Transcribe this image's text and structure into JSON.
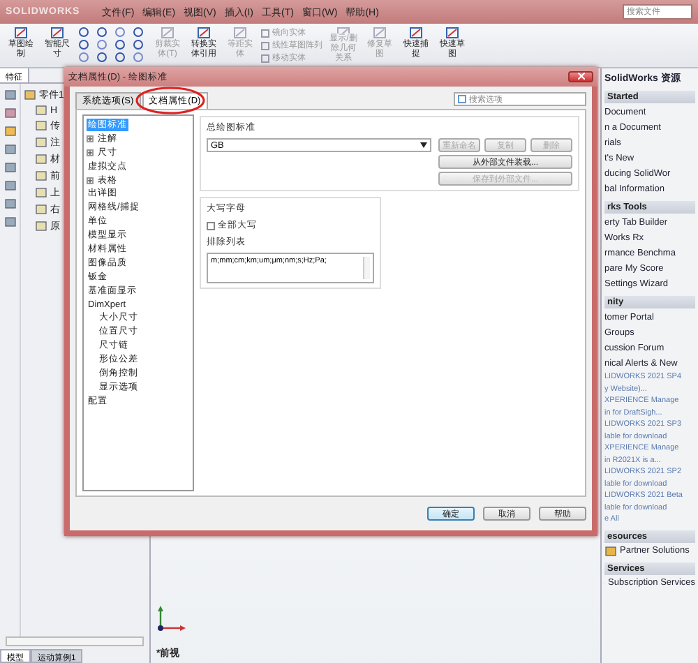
{
  "menu_bar": {
    "logo": "SOLIDWORKS",
    "items": [
      "文件(F)",
      "编辑(E)",
      "视图(V)",
      "插入(I)",
      "工具(T)",
      "窗口(W)",
      "帮助(H)"
    ],
    "search": {
      "placeholder": "搜索文件"
    }
  },
  "ribbon": {
    "groups": [
      {
        "kind": "large",
        "tools": [
          {
            "label": "草图绘制",
            "disabled": false
          },
          {
            "label": "智能尺寸",
            "disabled": false
          }
        ]
      },
      {
        "kind": "icons"
      },
      {
        "kind": "large",
        "tools": [
          {
            "label": "剪裁实体(T)",
            "disabled": true
          },
          {
            "label": "转换实体引用",
            "disabled": false
          },
          {
            "label": "等距实体",
            "disabled": true
          }
        ]
      },
      {
        "kind": "stack",
        "tools": [
          {
            "label": "镜向实体",
            "disabled": true
          },
          {
            "label": "线性草图阵列",
            "disabled": true
          },
          {
            "label": "移动实体",
            "disabled": true
          }
        ]
      },
      {
        "kind": "large",
        "tools": [
          {
            "label": "显示/删除几何关系",
            "disabled": true
          },
          {
            "label": "修复草图",
            "disabled": true
          },
          {
            "label": "快速捕捉",
            "disabled": false
          },
          {
            "label": "快速草图",
            "disabled": false
          }
        ]
      }
    ]
  },
  "feature_manager": {
    "tabs": [
      {
        "label": "特征",
        "selected": true
      }
    ],
    "tree": [
      {
        "label": "零件1",
        "children": [
          {
            "label": "H"
          },
          {
            "label": "传"
          },
          {
            "label": "注"
          },
          {
            "label": "材"
          },
          {
            "label": "前"
          },
          {
            "label": "上"
          },
          {
            "label": "右"
          },
          {
            "label": "原"
          }
        ]
      }
    ],
    "bottom_tabs": [
      {
        "label": "模型",
        "selected": true
      },
      {
        "label": "运动算例1",
        "selected": false
      }
    ]
  },
  "graphics": {
    "view_label": "*前视"
  },
  "task_pane": {
    "title": "SolidWorks 资源",
    "sections": [
      {
        "title": "Started",
        "items": [
          {
            "kind": "link",
            "label": "Document"
          },
          {
            "kind": "link",
            "label": "n a Document"
          },
          {
            "kind": "link",
            "label": "rials"
          },
          {
            "kind": "link",
            "label": "t's New"
          },
          {
            "kind": "link",
            "label": "ducing SolidWor"
          },
          {
            "kind": "link",
            "label": "bal Information"
          }
        ]
      },
      {
        "title": "rks Tools",
        "items": [
          {
            "kind": "link",
            "label": "erty Tab Builder"
          },
          {
            "kind": "link",
            "label": "Works Rx"
          },
          {
            "kind": "link",
            "label": "rmance Benchma"
          },
          {
            "kind": "link",
            "label": "pare My Score"
          },
          {
            "kind": "link",
            "label": "Settings Wizard"
          }
        ]
      },
      {
        "title": "nity",
        "items": [
          {
            "kind": "link",
            "label": "tomer Portal"
          },
          {
            "kind": "link",
            "label": "Groups"
          },
          {
            "kind": "link",
            "label": "cussion Forum"
          },
          {
            "kind": "link",
            "label": "nical Alerts & New"
          },
          {
            "kind": "news",
            "label": "LIDWORKS 2021 SP4"
          },
          {
            "kind": "news",
            "label": "y Website)..."
          },
          {
            "kind": "news",
            "label": "XPERIENCE Manage"
          },
          {
            "kind": "news",
            "label": "in for DraftSigh..."
          },
          {
            "kind": "news",
            "label": "LIDWORKS 2021 SP3"
          },
          {
            "kind": "news",
            "label": "lable for download"
          },
          {
            "kind": "news",
            "label": "XPERIENCE Manage"
          },
          {
            "kind": "news",
            "label": "in R2021X is a..."
          },
          {
            "kind": "news",
            "label": "LIDWORKS 2021 SP2"
          },
          {
            "kind": "news",
            "label": "lable for download"
          },
          {
            "kind": "news",
            "label": "LIDWORKS 2021 Beta"
          },
          {
            "kind": "news",
            "label": "lable for download"
          },
          {
            "kind": "news",
            "label": "e All"
          }
        ]
      },
      {
        "title": "esources",
        "items": [
          {
            "kind": "icon-link",
            "label": "Partner Solutions"
          }
        ]
      },
      {
        "title": "Services",
        "items": [
          {
            "kind": "icon-link",
            "label": "Subscription Services"
          }
        ]
      }
    ]
  },
  "dialog": {
    "title": "文档属性(D) - 绘图标准",
    "tabs": [
      {
        "label": "系统选项(S)",
        "selected": false
      },
      {
        "label": "文档属性(D)",
        "selected": true
      }
    ],
    "search": {
      "placeholder": "搜索选项"
    },
    "tree": [
      {
        "label": "绘图标准",
        "selected": true
      },
      {
        "label": "注解",
        "selected": false,
        "expanded": false
      },
      {
        "label": "尺寸",
        "selected": false,
        "expanded": false
      },
      {
        "label": "虚拟交点",
        "selected": false
      },
      {
        "label": "表格",
        "selected": false,
        "expanded": false
      },
      {
        "label": "出详图",
        "selected": false
      },
      {
        "label": "网格线/捕捉",
        "selected": false
      },
      {
        "label": "单位",
        "selected": false
      },
      {
        "label": "模型显示",
        "selected": false
      },
      {
        "label": "材料属性",
        "selected": false
      },
      {
        "label": "图像品质",
        "selected": false
      },
      {
        "label": "钣金",
        "selected": false
      },
      {
        "label": "基准面显示",
        "selected": false
      },
      {
        "label": "DimXpert",
        "selected": false,
        "children": [
          {
            "label": "大小尺寸",
            "selected": false
          },
          {
            "label": "位置尺寸",
            "selected": false
          },
          {
            "label": "尺寸链",
            "selected": false
          },
          {
            "label": "形位公差",
            "selected": false
          },
          {
            "label": "倒角控制",
            "selected": false
          },
          {
            "label": "显示选项",
            "selected": false
          }
        ]
      },
      {
        "label": "配置",
        "selected": false
      }
    ],
    "standard": {
      "title": "总绘图标准",
      "value": "GB",
      "buttons": [
        {
          "label": "重新命名",
          "disabled": true
        },
        {
          "label": "复制",
          "disabled": true
        },
        {
          "label": "删除",
          "disabled": true
        }
      ],
      "file_buttons": [
        {
          "label": "从外部文件装载...",
          "disabled": false
        },
        {
          "label": "保存到外部文件...",
          "disabled": true
        }
      ]
    },
    "uppercase": {
      "title": "大写字母",
      "all_caps": {
        "label": "全部大写",
        "checked": false
      },
      "exclude_label": "排除列表",
      "exclude_value": "m;mm;cm;km;um;μm;nm;s;Hz;Pa;"
    },
    "buttons": [
      {
        "label": "确定",
        "default": true
      },
      {
        "label": "取消",
        "default": false
      },
      {
        "label": "帮助",
        "default": false
      }
    ]
  }
}
